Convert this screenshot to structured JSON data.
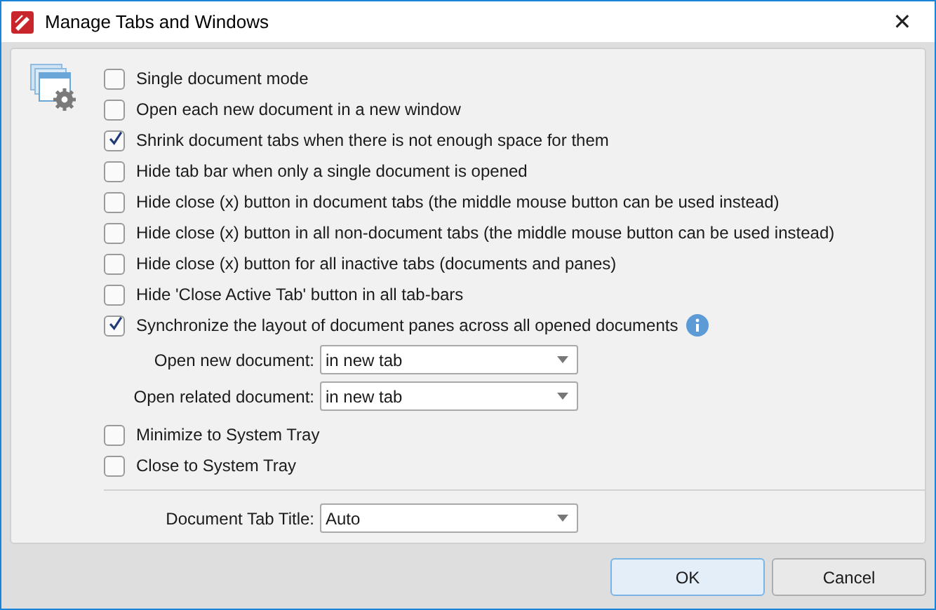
{
  "window": {
    "title": "Manage Tabs and Windows",
    "close": "✕"
  },
  "options": [
    {
      "label": "Single document mode",
      "checked": false
    },
    {
      "label": "Open each new document in a new window",
      "checked": false
    },
    {
      "label": "Shrink document tabs when there is not enough space for them",
      "checked": true
    },
    {
      "label": "Hide tab bar when only a single document is opened",
      "checked": false
    },
    {
      "label": "Hide close (x) button in document tabs (the middle mouse button can be used instead)",
      "checked": false
    },
    {
      "label": "Hide close (x) button in all non-document tabs (the middle mouse button can be used instead)",
      "checked": false
    },
    {
      "label": "Hide close (x) button for all inactive tabs (documents and panes)",
      "checked": false
    },
    {
      "label": "Hide 'Close Active Tab' button in all tab-bars",
      "checked": false
    },
    {
      "label": "Synchronize the layout of document panes across all opened documents",
      "checked": true,
      "info": true
    }
  ],
  "open_fields": [
    {
      "label": "Open new document:",
      "value": "in new tab"
    },
    {
      "label": "Open related document:",
      "value": "in new tab"
    }
  ],
  "tray_options": [
    {
      "label": "Minimize to System Tray",
      "checked": false
    },
    {
      "label": "Close to System Tray",
      "checked": false
    }
  ],
  "tab_title": {
    "label": "Document Tab Title:",
    "value": "Auto"
  },
  "buttons": [
    {
      "label": "OK",
      "default": true
    },
    {
      "label": "Cancel",
      "default": false
    }
  ]
}
